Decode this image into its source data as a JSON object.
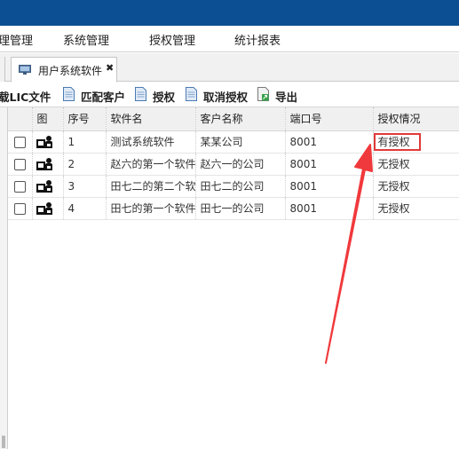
{
  "menu": {
    "items": [
      {
        "label": "理管理"
      },
      {
        "label": "系统管理"
      },
      {
        "label": "授权管理"
      },
      {
        "label": "统计报表"
      }
    ]
  },
  "tab": {
    "label": "用户系统软件",
    "close": "✖",
    "icon": "monitor-icon"
  },
  "toolbar": {
    "buttons": [
      {
        "label": "载LIC文件"
      },
      {
        "label": "匹配客户",
        "icon": "document-icon"
      },
      {
        "label": "授权",
        "icon": "document-icon"
      },
      {
        "label": "取消授权",
        "icon": "document-icon"
      },
      {
        "label": "导出",
        "icon": "export-icon"
      }
    ]
  },
  "table": {
    "headers": {
      "icon": "图",
      "index": "序号",
      "software": "软件名",
      "customer": "客户名称",
      "port": "端口号",
      "auth": "授权情况"
    },
    "rows": [
      {
        "index": "1",
        "software": "测试系统软件",
        "customer": "某某公司",
        "port": "8001",
        "auth": "有授权"
      },
      {
        "index": "2",
        "software": "赵六的第一个软件",
        "customer": "赵六一的公司",
        "port": "8001",
        "auth": "无授权"
      },
      {
        "index": "3",
        "software": "田七二的第二个软件",
        "customer": "田七二的公司",
        "port": "8001",
        "auth": "无授权"
      },
      {
        "index": "4",
        "software": "田七的第一个软件",
        "customer": "田七一的公司",
        "port": "8001",
        "auth": "无授权"
      }
    ]
  },
  "colors": {
    "topbar": "#0d4f93",
    "highlight": "#e03a3a",
    "arrow": "#f0393c"
  }
}
